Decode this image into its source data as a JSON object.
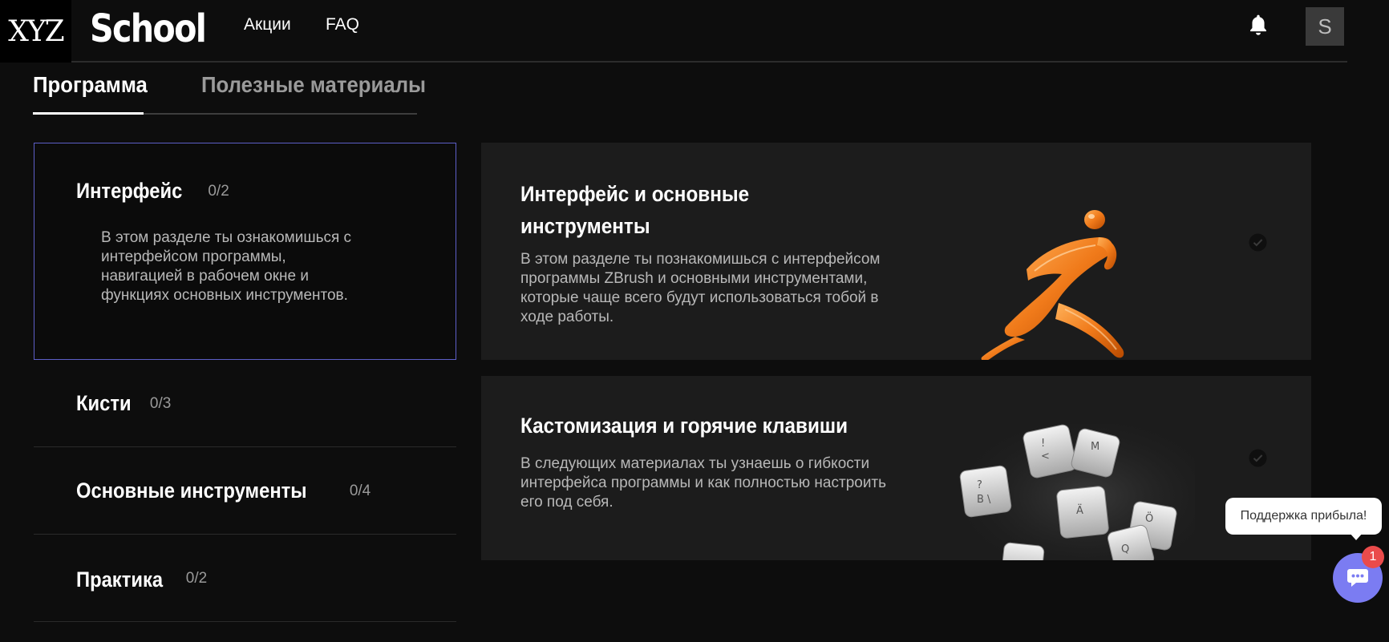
{
  "header": {
    "logo": "XYZ",
    "brand": "School",
    "nav": [
      {
        "label": "Акции"
      },
      {
        "label": "FAQ"
      }
    ],
    "avatar_letter": "S"
  },
  "tabs": [
    {
      "label": "Программа",
      "active": true
    },
    {
      "label": "Полезные материалы",
      "active": false
    }
  ],
  "sections": [
    {
      "title": "Интерфейс",
      "count": "0/2",
      "description": "В этом разделе ты ознакомишься с интерфейсом программы, навигацией в рабочем окне и функциях основных инструментов.",
      "active": true
    },
    {
      "title": "Кисти",
      "count": "0/3"
    },
    {
      "title": "Основные инструменты",
      "count": "0/4"
    },
    {
      "title": "Практика",
      "count": "0/2"
    }
  ],
  "cards": [
    {
      "title": "Интерфейс и основные инструменты",
      "description": "В этом разделе ты познакомишься с интерфейсом программы ZBrush и основными инструментами, которые чаще всего будут использоваться тобой в ходе работы.",
      "icon": "zbrush-logo-illustration"
    },
    {
      "title": "Кастомизация и горячие клавиши",
      "description": "В следующих материалах ты узнаешь о гибкости интерфейса программы и как полностью настроить его под себя.",
      "icon": "keyboard-keys-illustration"
    }
  ],
  "support": {
    "bubble": "Поддержка прибыла!",
    "badge": "1"
  },
  "colors": {
    "background": "#0d0d0d",
    "card": "#1c1c1c",
    "active_border": "#5d5fc7",
    "chat_button": "#7b7cf2",
    "badge": "#ea4b4b",
    "zbrush_orange": "#f07a1a"
  }
}
